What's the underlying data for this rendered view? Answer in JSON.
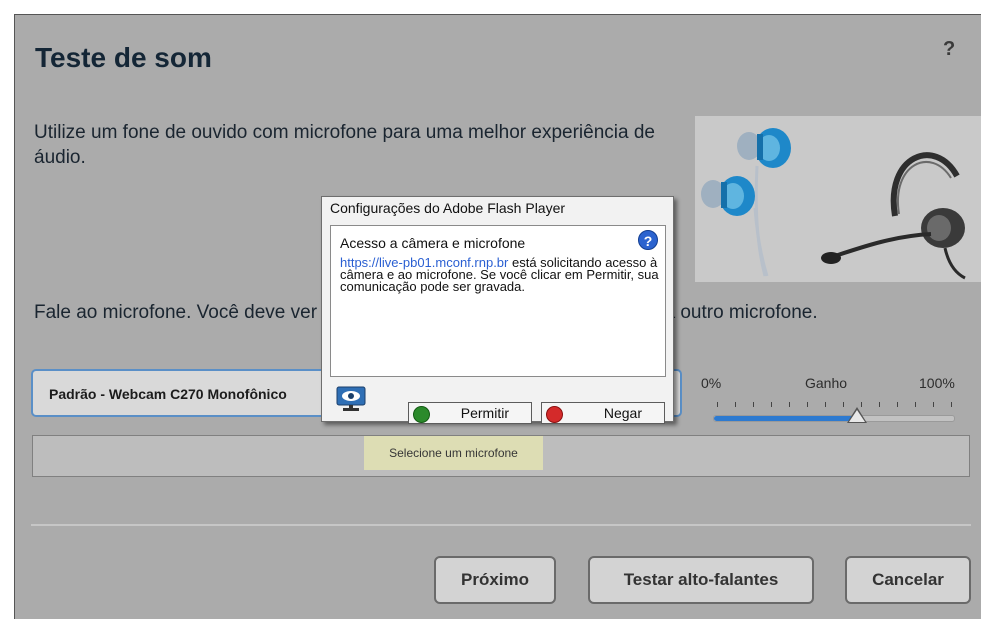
{
  "dialog": {
    "title": "Teste de som",
    "help": "?",
    "intro": "Utilize um fone de ouvido com microfone para uma melhor experiência de áudio.",
    "speak_prompt": "Fale ao microfone. Você deve ver a barra se mover. Caso contrário, escolha outro microfone.",
    "microphone_selected": "Padrão - Webcam C270 Monofônico",
    "gain": {
      "min_label": "0%",
      "label": "Ganho",
      "max_label": "100%",
      "level": 0.6
    },
    "tooltip": "Selecione um microfone",
    "buttons": {
      "next": "Próximo",
      "test_speakers": "Testar alto-falantes",
      "cancel": "Cancelar"
    }
  },
  "flash_settings": {
    "title": "Configurações do Adobe Flash Player",
    "heading": "Acesso a câmera e microfone",
    "url": "https://live-pb01.mconf.rnp.br",
    "message": " está solicitando acesso à câmera e ao microfone. Se você clicar em Permitir, sua comunicação pode ser gravada.",
    "allow": "Permitir",
    "deny": "Negar"
  },
  "colors": {
    "dialog_bg": "#ababab",
    "title": "#142636",
    "accent": "#2d7ad0",
    "tooltip_bg": "#ddddb4"
  }
}
